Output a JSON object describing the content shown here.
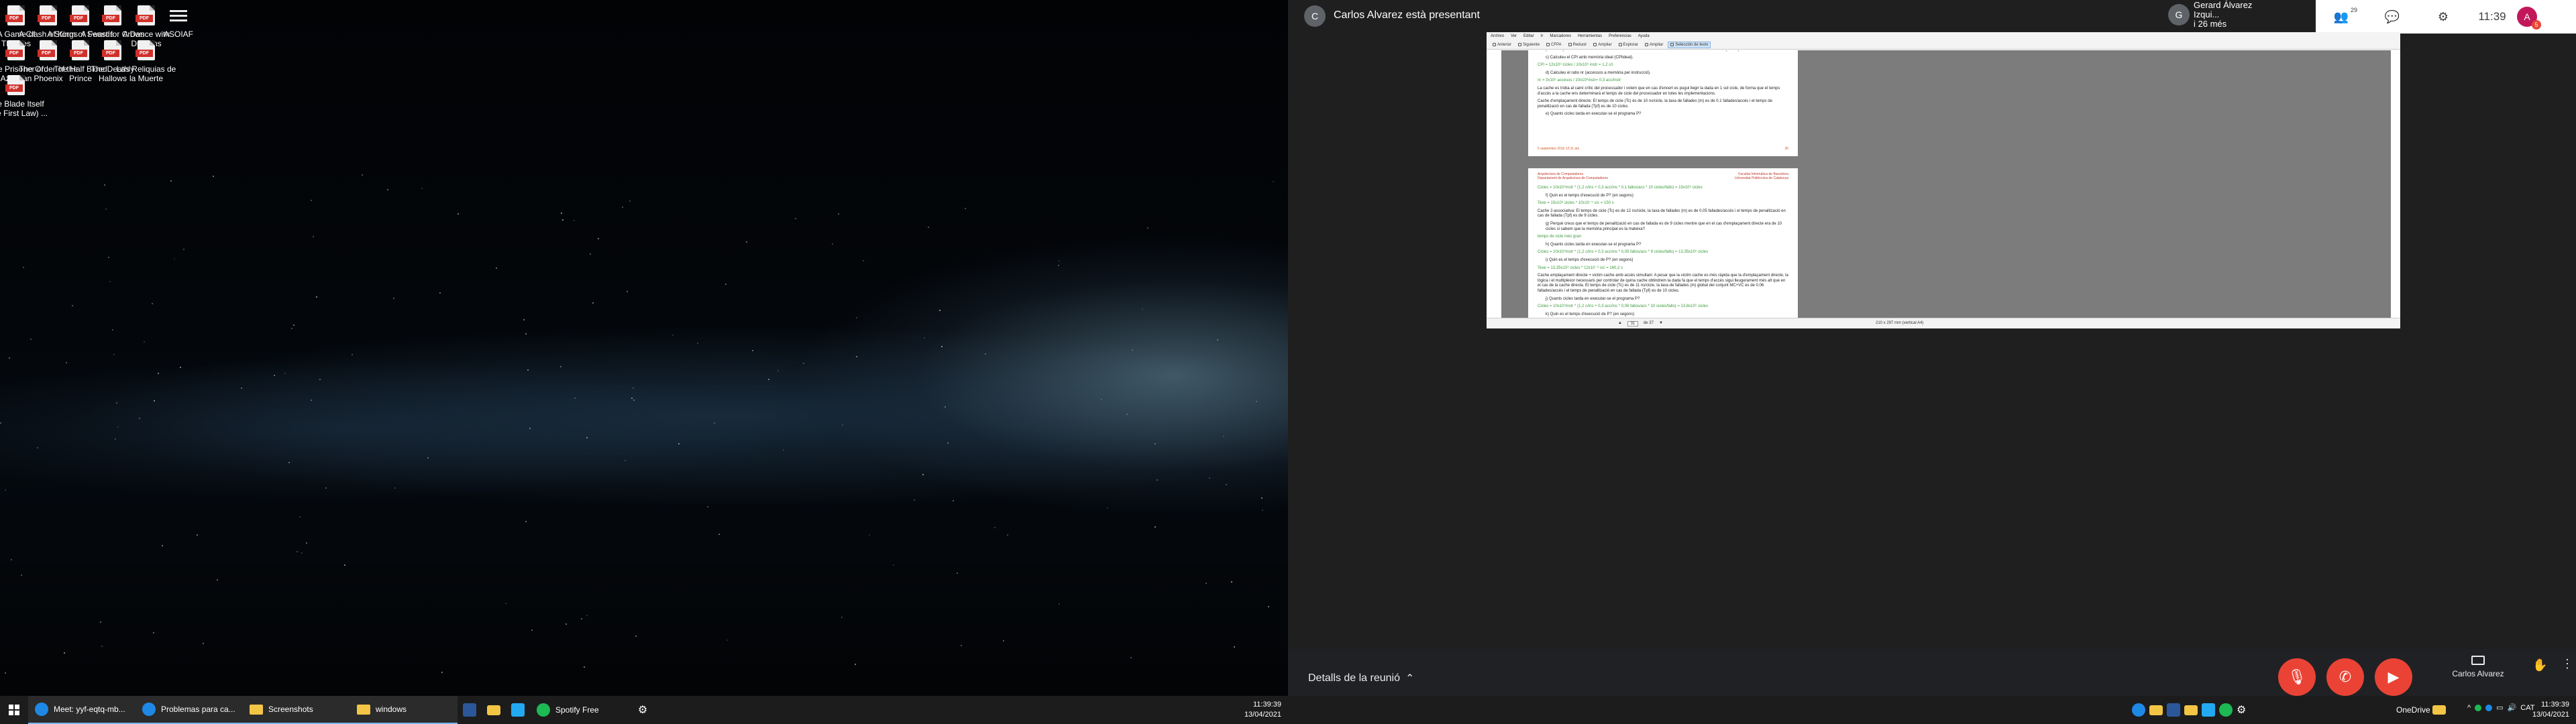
{
  "desktop": {
    "icons": [
      {
        "label": "A Game of Thrones",
        "type": "pdf"
      },
      {
        "label": "A Clash of Kings",
        "type": "pdf"
      },
      {
        "label": "A Storm of Swords",
        "type": "pdf"
      },
      {
        "label": "A Feast for Crows",
        "type": "pdf"
      },
      {
        "label": "A Dance with Dragons",
        "type": "pdf"
      },
      {
        "label": "ASOIAF",
        "type": "asciiaf"
      },
      {
        "label": "The Prisoner of Azkaban",
        "type": "pdf"
      },
      {
        "label": "The Order of the Phoenix",
        "type": "pdf"
      },
      {
        "label": "The Half Blood Prince",
        "type": "pdf"
      },
      {
        "label": "The Deathly Hallows",
        "type": "pdf"
      },
      {
        "label": "Las Reliquias de la Muerte",
        "type": "pdf"
      },
      {
        "label": "The Blade Itself (The First Law) ...",
        "type": "pdf"
      }
    ],
    "pdf_badge": "PDF"
  },
  "left_taskbar": {
    "items": [
      {
        "label": "Meet: yyf-eqtq-mb...",
        "icon": "edge-icon",
        "color": "#1e88e5"
      },
      {
        "label": "Problemas para ca...",
        "icon": "edge-icon",
        "color": "#1e88e5"
      },
      {
        "label": "Screenshots",
        "icon": "folder-icon",
        "color": "#f3c545"
      },
      {
        "label": "windows",
        "icon": "folder-icon",
        "color": "#f3c545"
      }
    ],
    "pinned": [
      "word-icon",
      "explorer-icon",
      "vscode-icon"
    ],
    "spotify_label": "Spotify Free",
    "time": "11:39:39",
    "date": "13/04/2021"
  },
  "meet": {
    "presenter_initial": "C",
    "presenter_title": "Carlos Alvarez està presentant",
    "participant_initial": "G",
    "participant_name": "Gerard Álvarez Izqui...",
    "participant_sub": "i 26 més",
    "top_icons": [
      {
        "name": "people-icon",
        "glyph": "👥",
        "badge": "29"
      },
      {
        "name": "chat-icon",
        "glyph": "💬",
        "badge": ""
      },
      {
        "name": "activities-icon",
        "glyph": "⚙",
        "badge": ""
      }
    ],
    "clock": "11:39",
    "user_initial": "A",
    "user_badge": "5",
    "details_label": "Detalls de la reunió",
    "present_label": "Carlos Alvarez",
    "accent": "#ea4335"
  },
  "pdf_viewer": {
    "menu": [
      "Archivo",
      "Ver",
      "Editar",
      "Ir",
      "Marcadores",
      "Herramientas",
      "Preferencias",
      "Ayuda"
    ],
    "toolbar": [
      "Anterior",
      "Siguiente",
      "CFPA",
      "Reducir",
      "Ampliar",
      "Explorar",
      "Ampliar",
      "Selección de texto"
    ],
    "page_current": "31",
    "page_of": "de 37",
    "page_size": "210 x 297 mm (vertical A4)",
    "page_top_lines": [
      {
        "cls": "pp",
        "text": "cicle) sabent que ha executat 10x10⁹ instruccions en 12x10⁹ cicles i s'han fet 3x10⁹ accessos a memòria (dades)."
      },
      {
        "cls": "qq",
        "text": "c)   Calculeu el CPI amb memòria ideal (CPIideal)."
      },
      {
        "cls": "pp g",
        "text": "CPI = 12x10⁹ cicles / 10x10⁹ instr = 1,2 c/i"
      },
      {
        "cls": "qq",
        "text": "d)   Calculeu el ratio nr (accessos a memòria per instrucció)."
      },
      {
        "cls": "pp g",
        "text": "nr = 3x10⁹ accesos / 10x10⁹instr= 0,3 acc/instr"
      },
      {
        "cls": "pp",
        "text": "La cache es troba al camí crític del processador i volem que en cas d'encert es pugui llegir la dada en 1 sol cicle, de forma que el temps d'accés a la cache ens determinarà el temps de cicle del processador en totes les implementacions."
      },
      {
        "cls": "pp",
        "text": "Cache d'emplaçament directe: El temps de cicle (Tc) és de 10 ns/cicle, la taxa de fallades (m) es de 0.1 fallades/accés i el temps de penalització en cas de fallada (Tpf) es de 10 cicles."
      },
      {
        "cls": "qq",
        "text": "e)   Quants cicles tarda en executar-se el programa P?"
      }
    ],
    "page_top_foot_left": "5 septembre 2016 12:11 am",
    "page_top_foot_right": "30",
    "page_bottom_head_left": "Arquitectura de Computadores\nDepartament de Arquitectura de Computadores",
    "page_bottom_head_right": "Facultat Informàtica de Barcelona\nUniversitat Politècnica de Catalunya",
    "page_bottom_lines": [
      {
        "cls": "pp g",
        "text": "Cicles = 10x10⁹instr * (1,2 c/ins + 0,3 acc/ins * 0,1 fallos/acc * 10 cicles/fallo) = 15x10⁹ cicles"
      },
      {
        "cls": "qq",
        "text": "f)   Quin es el temps d'execució de P? (en segons)"
      },
      {
        "cls": "pp g",
        "text": "Texe = 15x10⁹ cicles * 10x10⁻⁹ s/c = 150 s"
      },
      {
        "cls": "pp",
        "text": "Cache 2-associativa: El temps de cicle (Tc) es de 12 ns/cicle, la taxa de fallades (m) es de 0.05 fallades/accés i el temps de penalització en cas de fallada (Tpf) es de 9 cicles."
      },
      {
        "cls": "qq",
        "text": "g)   Perquè creus que el temps de penalització en cas de fallada es de 9 cicles mentre que en el cas d'emplaçament directe era de 10 cicles si sabem que la memòria principal es la mateixa?"
      },
      {
        "cls": "pp g",
        "text": "temps de cicle més gran"
      },
      {
        "cls": "qq",
        "text": "h)   Quants cicles tarda en executar-se el programa P?"
      },
      {
        "cls": "pp g",
        "text": "Cicles = 10x10⁹instr * (1,2 c/ins + 0,3 acc/ins * 0,05 fallos/acc * 9 cicles/fallo) = 13,35x10⁹ cicles"
      },
      {
        "cls": "qq",
        "text": "i)   Quin es el temps d'execució de P? (en segons)"
      },
      {
        "cls": "pp g",
        "text": "Texe = 13,35x10⁹ cicles * 12x10⁻⁹ s/c = 160,2 s"
      },
      {
        "cls": "pp",
        "text": "Cache emplaçament directe + victim cache amb accés simultani: A pesar que la victim cache es més ràpida que la d'emplaçament directe, la lògica i el multiplexor necessaris per controlar de quina cache obtindrem la dada fa que el temps d'accés sigui lleugerament més alt que en el cas de la cache directa. El temps de cicle (Tc) es de 11 ns/cicle, la taxa de fallades (m) global del conjunt MC+VC es de 0.06 fallades/accés i el temps de penalització en cas de fallada (Tpf) es de 10 cicles."
      },
      {
        "cls": "qq",
        "text": "j)   Quants cicles tarda en executar-se el programa P?"
      },
      {
        "cls": "pp g",
        "text": "Cicles = 10x10⁹instr * (1,2 c/ins + 0,3 acc/ins * 0,06 fallos/acc * 10 cicles/fallo) = 13,8x10⁹ cicles"
      },
      {
        "cls": "qq",
        "text": "k)   Quin es el temps d'execució de P? (en segons)"
      },
      {
        "cls": "pp g",
        "text": "Texe = 13,8x10⁹ cicles * 11x10⁻⁹ s/c = 151,8 s"
      },
      {
        "cls": "pp",
        "text": "Cache emplaçament directe + victim cache amb accés seqüencial: En aquesta segona implementació, els accessos que s'han de fer a la victim cache tenen una penalització addicional de un cicle, però el temps de cicle es el de la"
      }
    ]
  },
  "right_taskbar": {
    "onedrive_label": "OneDrive",
    "lang": "CAT",
    "time": "11:39:39",
    "date": "13/04/2021"
  }
}
